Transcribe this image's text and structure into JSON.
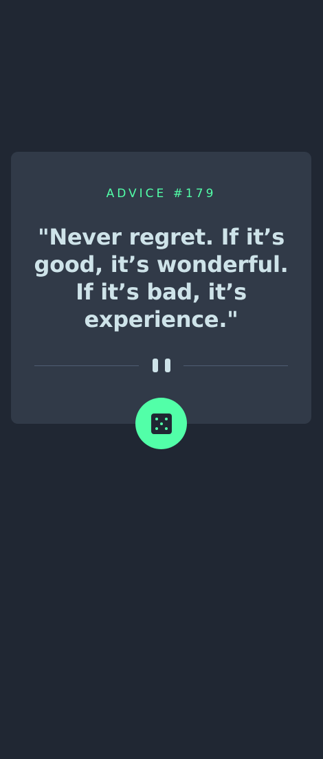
{
  "advice": {
    "id_label": "ADVICE #179",
    "quote": "\"Never regret. If it’s good, it’s wonderful. If it’s bad, it’s experience.\""
  },
  "icons": {
    "divider": "pause-icon",
    "button": "dice-icon"
  },
  "colors": {
    "background": "#202733",
    "card": "#313a48",
    "accent": "#52ffa8",
    "text": "#cee3e9",
    "divider": "#4f5d74"
  }
}
